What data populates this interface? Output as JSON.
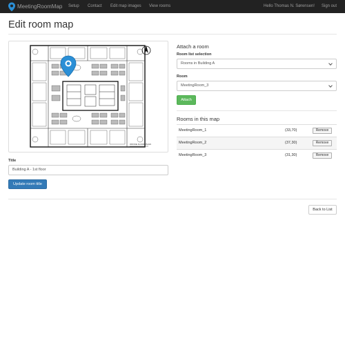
{
  "navbar": {
    "brand": "MeetingRoomMap",
    "links": [
      "Setup",
      "Contact",
      "Edit map images",
      "View rooms"
    ],
    "greeting": "Hello Thomas N. Sørensen!",
    "signout": "Sign out"
  },
  "page": {
    "title": "Edit room map"
  },
  "map": {
    "floor_plan_label": "OFFICE FLOOR PLAN",
    "marker_color": "#2b8fd6"
  },
  "title_form": {
    "label": "Title",
    "value": "Building A - 1st floor",
    "button": "Update room title"
  },
  "attach": {
    "heading": "Attach a room",
    "list_label": "Room list selection",
    "list_value": "Rooms in Building A",
    "room_label": "Room",
    "room_value": "MeetingRoom_3",
    "button": "Attach"
  },
  "rooms": {
    "heading": "Rooms in this map",
    "items": [
      {
        "name": "MeetingRoom_1",
        "coords": "(33,70)",
        "action": "Remove"
      },
      {
        "name": "MeetingRoom_2",
        "coords": "(37,30)",
        "action": "Remove"
      },
      {
        "name": "MeetingRoom_3",
        "coords": "(31,30)",
        "action": "Remove"
      }
    ]
  },
  "footer": {
    "back_button": "Back to List"
  },
  "colors": {
    "navbar": "#222222",
    "primary": "#337ab7",
    "success": "#5cb85c"
  }
}
